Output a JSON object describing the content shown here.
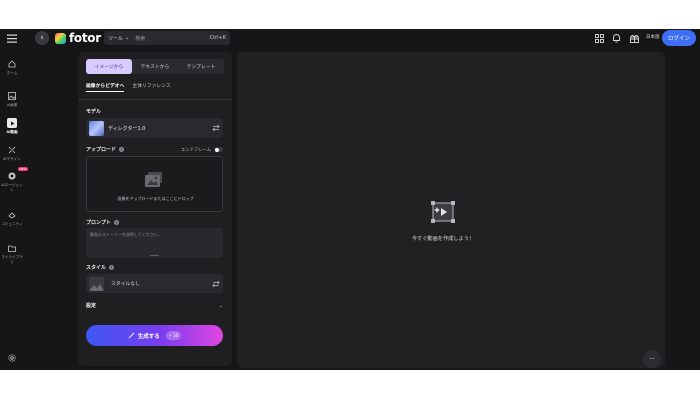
{
  "topbar": {
    "logo_text": "fotor",
    "search": {
      "tool_label": "ツール",
      "keyword_label": "検索",
      "shortcut": "Ctrl+K"
    },
    "language_label": "日本語",
    "login_label": "ログイン",
    "icons": [
      "menu-icon",
      "back-icon",
      "apps-icon",
      "bell-icon",
      "gift-icon"
    ]
  },
  "rail": {
    "items": [
      {
        "label": "ホーム",
        "icon": "home-icon"
      },
      {
        "label": "AI画像",
        "icon": "image-icon"
      },
      {
        "label": "AI動画",
        "icon": "video-icon"
      },
      {
        "label": "AIデザイン",
        "icon": "design-icon"
      },
      {
        "label": "AIエージェント",
        "icon": "agent-icon",
        "badge": "NEW"
      },
      {
        "label": "コミュニティ",
        "icon": "community-icon"
      },
      {
        "label": "マイライブラリ",
        "icon": "folder-icon"
      }
    ],
    "settings_icon": "gear-icon"
  },
  "panel": {
    "mode_tabs": [
      "イメージから",
      "テキストから",
      "テンプレート"
    ],
    "active_mode": 0,
    "sub_tabs": [
      "画像からビデオへ",
      "主体リファレンス"
    ],
    "active_sub_tab": 0,
    "model": {
      "label": "モデル",
      "value": "ディレクター1.0"
    },
    "upload": {
      "label": "アップロード",
      "endframe_label": "エンドフレーム",
      "hint": "画像をアップロードまたはここにドロップ"
    },
    "prompt": {
      "label": "プロンプト",
      "placeholder": "動画のストーリーを説明してください..."
    },
    "style": {
      "label": "スタイル",
      "value": "スタイルなし"
    },
    "settings_label": "設定",
    "generate": {
      "label": "生成する",
      "credits": "10"
    }
  },
  "canvas": {
    "empty_text": "今すぐ動画を作成しよう！"
  },
  "colors": {
    "accent_tab": "#d8ccff",
    "login": "#3d6ef5",
    "generate_start": "#3d57f2",
    "generate_end": "#e046e0",
    "background": "#161618"
  }
}
